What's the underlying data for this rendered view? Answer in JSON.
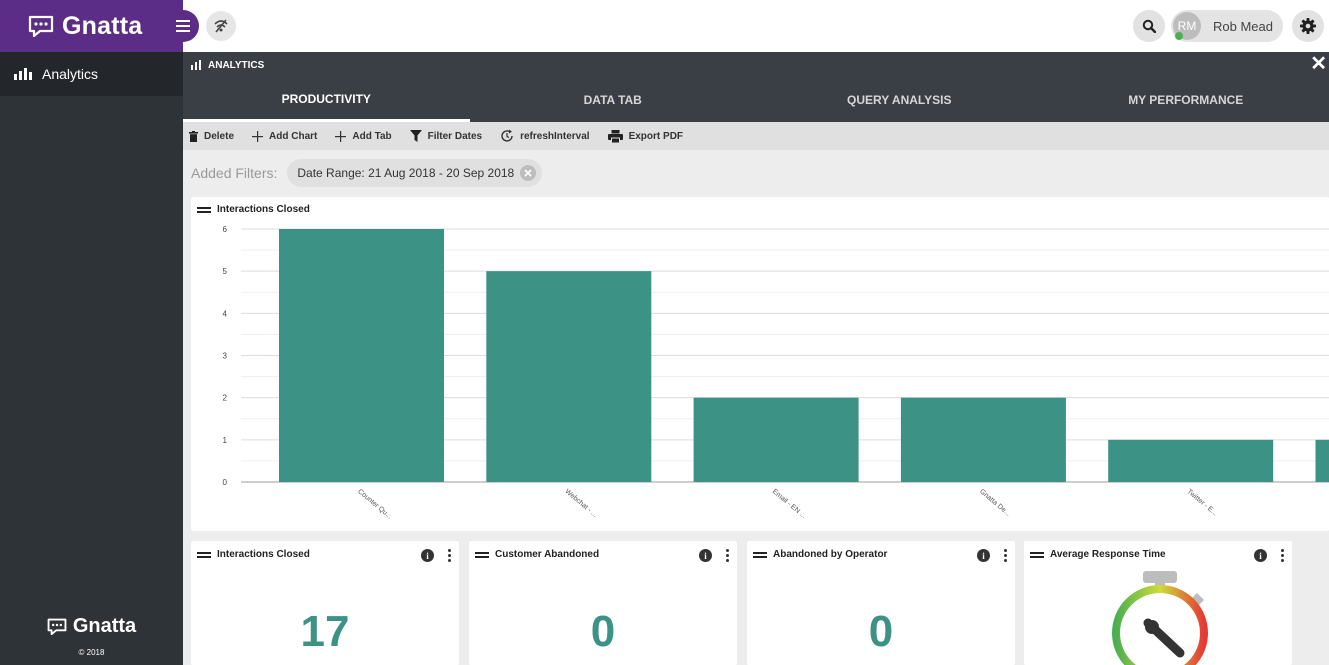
{
  "app": {
    "brand_name": "Gnatta",
    "brand_color": "#5b2d86",
    "user_initials": "RM",
    "user_name": "Rob Mead",
    "footer_brand": "Gnatta",
    "copyright": "© 2018"
  },
  "sidebar": {
    "items": [
      {
        "label": "Analytics",
        "icon": "bar-chart-icon",
        "active": true
      }
    ]
  },
  "panel": {
    "title": "ANALYTICS",
    "tabs": [
      {
        "label": "PRODUCTIVITY",
        "active": true
      },
      {
        "label": "DATA TAB",
        "active": false
      },
      {
        "label": "QUERY ANALYSIS",
        "active": false
      },
      {
        "label": "MY PERFORMANCE",
        "active": false
      }
    ]
  },
  "toolbar": {
    "delete_label": "Delete",
    "add_chart_label": "Add Chart",
    "add_tab_label": "Add Tab",
    "filter_dates_label": "Filter Dates",
    "refresh_label": "refreshInterval",
    "export_label": "Export PDF"
  },
  "filters": {
    "label": "Added Filters:",
    "chips": [
      "Date Range: 21 Aug 2018 - 20 Sep 2018"
    ]
  },
  "chart_card": {
    "title": "Interactions Closed"
  },
  "chart_data": {
    "type": "bar",
    "title": "Interactions Closed",
    "categories": [
      "Counter Qu...",
      "Webchat - ...",
      "Email - EN ...",
      "Gnatta De...",
      "Twitter - E...",
      ""
    ],
    "values": [
      6,
      5,
      2,
      2,
      1,
      1
    ],
    "ylim": [
      0,
      6
    ],
    "yticks": [
      0,
      1,
      2,
      3,
      4,
      5,
      6
    ],
    "grid": true,
    "color": "#3d9286"
  },
  "widgets": [
    {
      "title": "Interactions Closed",
      "value": "17"
    },
    {
      "title": "Customer Abandoned",
      "value": "0"
    },
    {
      "title": "Abandoned by Operator",
      "value": "0"
    },
    {
      "title": "Average Response Time",
      "value": ""
    }
  ]
}
